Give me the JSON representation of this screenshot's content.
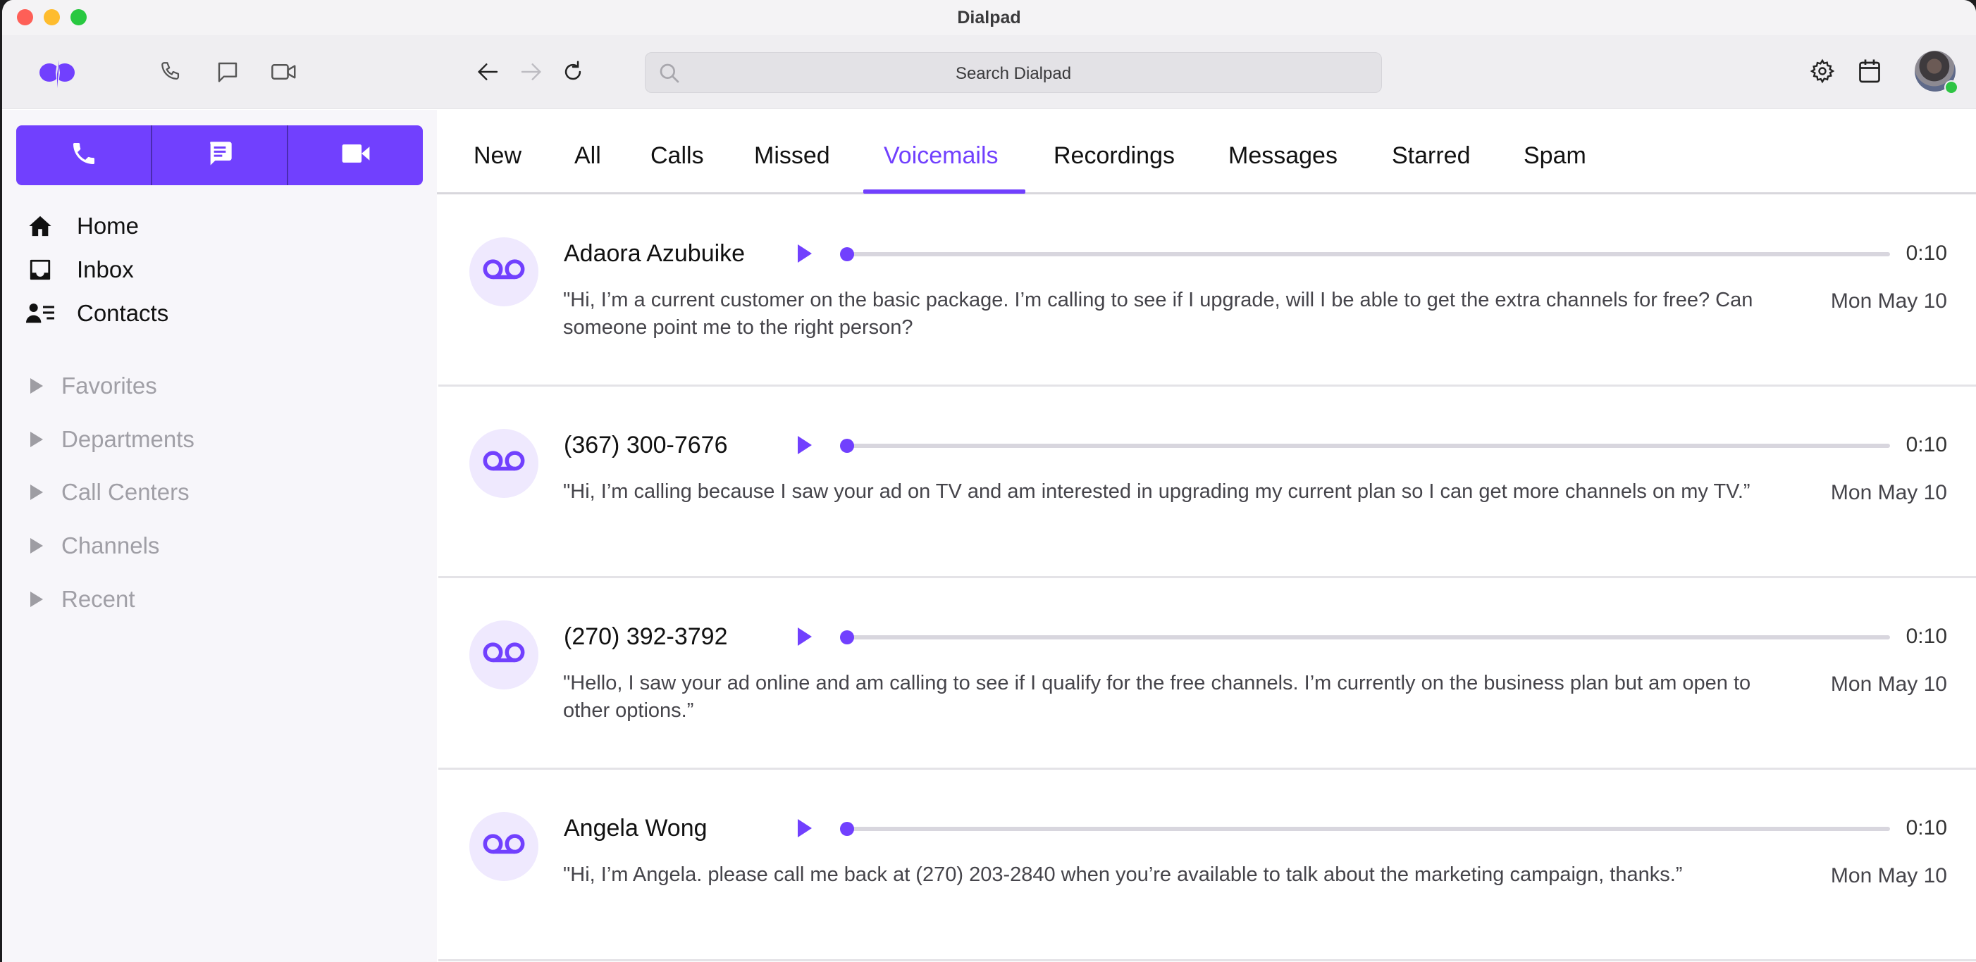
{
  "window": {
    "title": "Dialpad"
  },
  "toolbar": {
    "logo": "dialpad-logo",
    "quick_icons": [
      "phone-icon",
      "chat-icon",
      "video-icon"
    ],
    "nav_icons": [
      "back-arrow-icon",
      "forward-arrow-icon",
      "refresh-icon"
    ],
    "search": {
      "placeholder": "Search Dialpad",
      "value": ""
    },
    "right_icons": [
      "gear-icon",
      "calendar-icon"
    ],
    "user": {
      "presence": "online",
      "presence_color": "#2ec444"
    }
  },
  "sidebar": {
    "primary_actions": [
      {
        "name": "call",
        "icon": "phone-icon"
      },
      {
        "name": "message",
        "icon": "message-icon"
      },
      {
        "name": "video",
        "icon": "video-icon"
      }
    ],
    "nav": [
      {
        "label": "Home",
        "icon": "home-icon"
      },
      {
        "label": "Inbox",
        "icon": "inbox-icon"
      },
      {
        "label": "Contacts",
        "icon": "contacts-icon"
      }
    ],
    "sections": [
      {
        "label": "Favorites",
        "expanded": false
      },
      {
        "label": "Departments",
        "expanded": false
      },
      {
        "label": "Call Centers",
        "expanded": false
      },
      {
        "label": "Channels",
        "expanded": false
      },
      {
        "label": "Recent",
        "expanded": false
      }
    ]
  },
  "tabs": {
    "items": [
      {
        "label": "New"
      },
      {
        "label": "All"
      },
      {
        "label": "Calls"
      },
      {
        "label": "Missed"
      },
      {
        "label": "Voicemails",
        "active": true
      },
      {
        "label": "Recordings"
      },
      {
        "label": "Messages"
      },
      {
        "label": "Starred"
      },
      {
        "label": "Spam"
      }
    ]
  },
  "voicemails": [
    {
      "caller": "Adaora Azubuike",
      "duration": "0:10",
      "progress": 0,
      "transcript": "\"Hi, I’m a current customer on the basic package. I’m calling to see if I upgrade, will I be able to get the extra channels for free? Can someone point me to the right person?",
      "date": "Mon May 10"
    },
    {
      "caller": "(367) 300-7676",
      "duration": "0:10",
      "progress": 0,
      "transcript": "\"Hi, I’m calling because I saw your ad on TV and am interested in upgrading my current plan so I can get more channels on my TV.”",
      "date": "Mon May 10"
    },
    {
      "caller": "(270) 392-3792",
      "duration": "0:10",
      "progress": 0,
      "transcript": "\"Hello, I saw your ad online and am calling to see if I qualify for the free channels. I’m currently on the business plan but am open to other options.”",
      "date": "Mon May 10"
    },
    {
      "caller": "Angela Wong",
      "duration": "0:10",
      "progress": 0,
      "transcript": "\"Hi, I’m Angela. please call me back at (270) 203-2840 when you’re available to talk about the marketing campaign, thanks.”",
      "date": "Mon May 10"
    }
  ],
  "colors": {
    "accent": "#7140fe",
    "voicemail_avatar_bg": "#efe9fe",
    "sidebar_bg": "#f7f6fa",
    "toolbar_bg": "#efeef1"
  }
}
